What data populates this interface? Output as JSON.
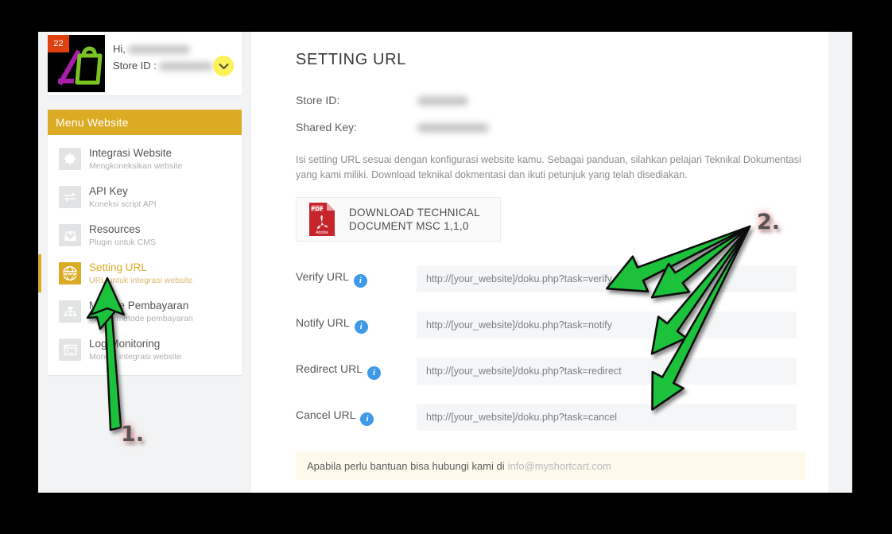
{
  "app": {
    "profile": {
      "badge_count": "22",
      "greeting_label": "Hi,",
      "store_id_label": "Store ID :",
      "name_redacted": true,
      "store_id_redacted": true,
      "dropdown_icon": "chevron-down-icon"
    },
    "sidebar": {
      "section_title": "Menu Website",
      "items": [
        {
          "title": "Integrasi Website",
          "subtitle": "Mengkoneksikan website",
          "icon": "gear-icon",
          "active": false
        },
        {
          "title": "API Key",
          "subtitle": "Koneksi script API",
          "icon": "exchange-arrows-icon",
          "active": false
        },
        {
          "title": "Resources",
          "subtitle": "Plugin untuk CMS",
          "icon": "inbox-download-icon",
          "active": false
        },
        {
          "title": "Setting URL",
          "subtitle": "URL untuk integrasi website",
          "icon": "www-globe-icon",
          "active": true
        },
        {
          "title": "Metode Pembayaran",
          "subtitle": "Pilihan metode pembayaran",
          "icon": "sitemap-icon",
          "active": false
        },
        {
          "title": "Log Monitoring",
          "subtitle": "Monitor integrasi website",
          "icon": "terminal-window-icon",
          "active": false
        }
      ]
    },
    "main": {
      "page_title": "SETTING URL",
      "store_id_label": "Store ID:",
      "shared_key_label": "Shared Key:",
      "store_id_value": "",
      "shared_key_value": "",
      "description": "Isi setting URL sesuai dengan konfigurasi website kamu. Sebagai panduan, silahkan pelajari Teknikal Dokumentasi yang kami miliki. Download teknikal dokmentasi dan ikuti petunjuk yang telah disediakan.",
      "download_button": {
        "line1": "DOWNLOAD TECHNICAL",
        "line2": "DOCUMENT MSC 1,1,0",
        "icon": "pdf-file-icon"
      },
      "fields": [
        {
          "label": "Verify URL",
          "info_icon": "info-icon",
          "value": "http://[your_website]/doku.php?task=verify"
        },
        {
          "label": "Notify URL",
          "info_icon": "info-icon",
          "value": "http://[your_website]/doku.php?task=notify"
        },
        {
          "label": "Redirect URL",
          "info_icon": "info-icon",
          "value": "http://[your_website]/doku.php?task=redirect"
        },
        {
          "label": "Cancel URL",
          "info_icon": "info-icon",
          "value": "http://[your_website]/doku.php?task=cancel"
        }
      ],
      "help": {
        "text": "Apabila perlu bantuan bisa hubungi kami di",
        "email": "info@myshortcart.com"
      }
    },
    "annotations": {
      "marker_1": "1.",
      "marker_2": "2.",
      "arrow_color": "#1bc23a"
    },
    "colors": {
      "brand_gold": "#dcab24",
      "accent_yellow": "#fdf158",
      "badge_red": "#e0400f",
      "info_blue": "#3d9ae8",
      "pdf_red": "#c6262b",
      "help_bg": "#fdfaeb",
      "page_bg": "#f2f3f4"
    }
  }
}
